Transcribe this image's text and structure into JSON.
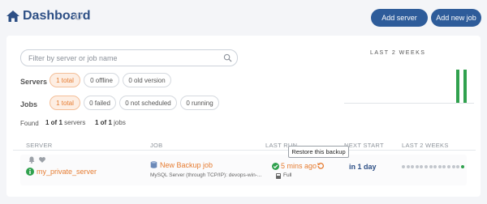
{
  "header": {
    "title": "Dashboard",
    "add_server_label": "Add server",
    "add_job_label": "Add new job"
  },
  "search": {
    "placeholder": "Filter by server or job name"
  },
  "filters": {
    "servers_label": "Servers",
    "servers": [
      "1 total",
      "0 offline",
      "0 old version"
    ],
    "jobs_label": "Jobs",
    "jobs": [
      "1 total",
      "0 failed",
      "0 not scheduled",
      "0 running"
    ]
  },
  "found": {
    "label": "Found",
    "servers_count": "1 of 1",
    "servers_word": "servers",
    "jobs_count": "1 of 1",
    "jobs_word": "jobs"
  },
  "chart": {
    "title": "LAST 2 WEEKS",
    "bar_color": "#30a14e"
  },
  "table": {
    "headers": [
      "SERVER",
      "JOB",
      "LAST RUN",
      "NEXT START",
      "LAST 2 WEEKS"
    ],
    "row": {
      "server_name": "my_private_server",
      "job_name": "New Backup job",
      "job_sub": "MySQL Server (through TCP/IP): devops-win-...",
      "last_run": "5 mins ago",
      "last_run_sub": "Full",
      "next_start": "in 1 day",
      "history": [
        "gray",
        "gray",
        "gray",
        "gray",
        "gray",
        "gray",
        "gray",
        "gray",
        "gray",
        "gray",
        "gray",
        "gray",
        "gray",
        "green"
      ]
    }
  },
  "tooltip": {
    "text": "Restore this backup"
  },
  "colors": {
    "accent": "#e67c31",
    "primary": "#2e5c9a",
    "success": "#30a14e"
  }
}
